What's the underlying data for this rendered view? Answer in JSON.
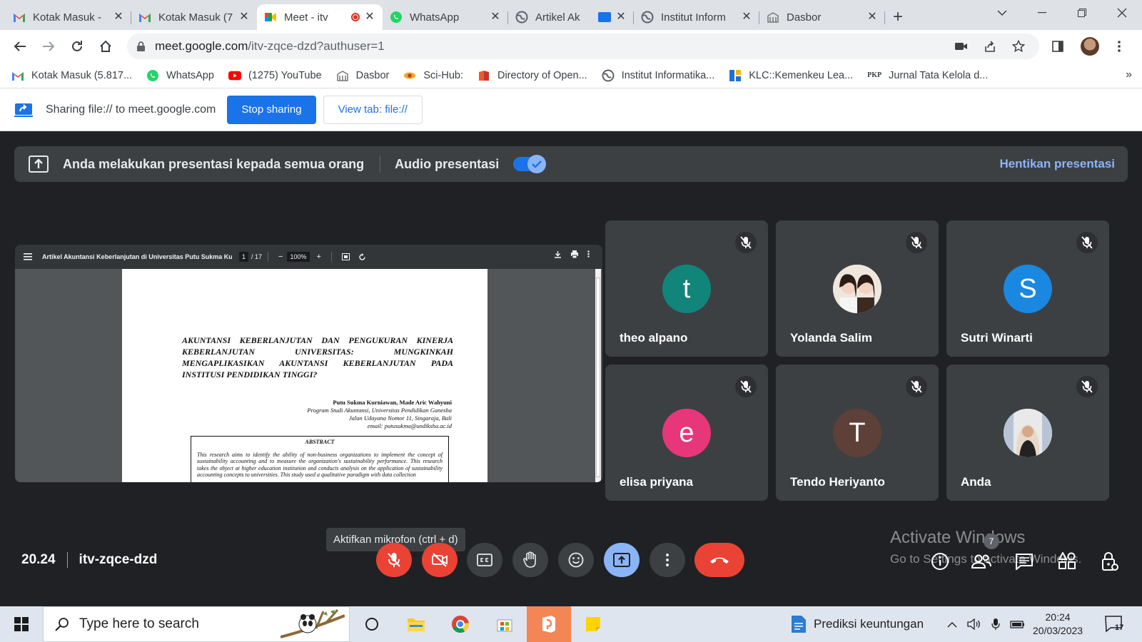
{
  "browser": {
    "tabs": [
      {
        "title": "Kotak Masuk - ",
        "icon": "gmail-icon"
      },
      {
        "title": "Kotak Masuk (7",
        "icon": "gmail-icon"
      },
      {
        "title": "Meet - itv",
        "icon": "meet-icon",
        "active": true
      },
      {
        "title": "WhatsApp",
        "icon": "whatsapp-icon"
      },
      {
        "title": "Artikel Ak",
        "icon": "globe-icon"
      },
      {
        "title": "Institut Inform",
        "icon": "globe-icon"
      },
      {
        "title": "Dasbor",
        "icon": "moodle-icon"
      }
    ],
    "url_host": "meet.google.com",
    "url_rest": "/itv-zqce-dzd?authuser=1",
    "bookmarks": [
      {
        "label": "Kotak Masuk (5.817...",
        "icon": "gmail-icon"
      },
      {
        "label": "WhatsApp",
        "icon": "whatsapp-icon"
      },
      {
        "label": "(1275) YouTube",
        "icon": "youtube-icon"
      },
      {
        "label": "Dasbor",
        "icon": "moodle-icon"
      },
      {
        "label": "Sci-Hub:",
        "icon": "scihub-icon"
      },
      {
        "label": "Directory of Open...",
        "icon": "doaj-icon"
      },
      {
        "label": "Institut Informatika...",
        "icon": "globe-icon"
      },
      {
        "label": "KLC::Kemenkeu Lea...",
        "icon": "klc-icon"
      },
      {
        "label": "Jurnal Tata Kelola d...",
        "icon": "pkp-icon",
        "prefix": "PKP"
      }
    ]
  },
  "sharing": {
    "text": "Sharing file:// to meet.google.com",
    "stop_label": "Stop sharing",
    "view_label": "View tab: file://"
  },
  "meet": {
    "banner_text": "Anda melakukan presentasi kepada semua orang",
    "audio_label": "Audio presentasi",
    "audio_on": true,
    "stop_label": "Hentikan presentasi",
    "pdf": {
      "title": "Artikel Akuntansi Keberlanjutan di Universitas Putu Sukma Kurn...",
      "page": "1",
      "total": "/ 17",
      "zoom": "100%",
      "heading": "AKUNTANSI KEBERLANJUTAN DAN PENGUKURAN KINERJA KEBERLANJUTAN UNIVERSITAS: MUNGKINKAH MENGAPLIKASIKAN AKUNTANSI KEBERLANJUTAN PADA INSTITUSI PENDIDIKAN TINGGI?",
      "authors": "Putu Sukma Kurniawan, Made Aric Wahyuni",
      "affil": "Program Studi Akuntansi, Universitas Pendidikan Ganesha",
      "address": "Jalan Udayana Nomor 11, Singaraja, Bali",
      "email": "email: putusukma@undiksha.ac.id",
      "abstract_title": "ABSTRACT",
      "abstract_text": "This research aims to identify the ability of non-business organizations to implement the concept of sustainability accounting and to measure the organization's sustainability performance. This research takes the object at higher education institution and conducts analysis on the application of sustainability accounting concepts to universities. This study used a qualitative paradigm with data collection"
    },
    "participants": [
      {
        "name": "theo alpano",
        "initial": "t",
        "color": "#12857a",
        "muted": true
      },
      {
        "name": "Yolanda Salim",
        "initial": "",
        "color": "#d7c4b6",
        "photo": true,
        "muted": true
      },
      {
        "name": "Sutri Winarti",
        "initial": "S",
        "color": "#1a88e0",
        "muted": true
      },
      {
        "name": "elisa priyana",
        "initial": "e",
        "color": "#e8367a",
        "muted": true
      },
      {
        "name": "Tendo Heriyanto",
        "initial": "T",
        "color": "#5d4037",
        "muted": true
      },
      {
        "name": "Anda",
        "initial": "",
        "color": "#e8e8e8",
        "photo": true,
        "muted": true
      }
    ],
    "tooltip": "Aktifkan mikrofon (ctrl + d)",
    "time": "20.24",
    "meeting_code": "itv-zqce-dzd",
    "watermark_line1": "Activate Windows",
    "watermark_line2": "Go to Settings to activate Windows.",
    "people_count": "7"
  },
  "taskbar": {
    "search_placeholder": "Type here to search",
    "tray_app": "Prediksi keuntungan",
    "time": "20:24",
    "date": "20/03/2023",
    "notifications": "17"
  }
}
